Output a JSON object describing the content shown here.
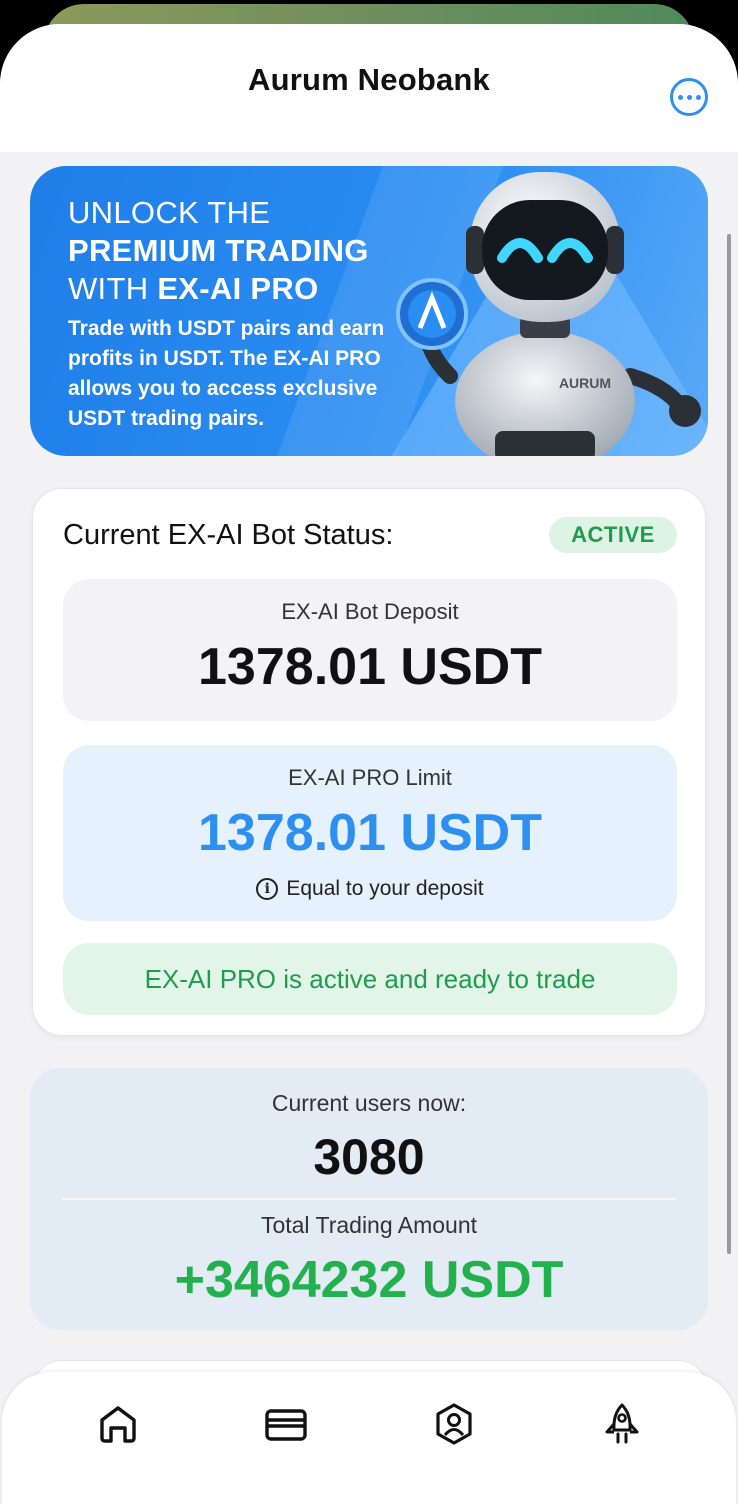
{
  "header": {
    "title": "Aurum Neobank",
    "more_icon": "more-horizontal-icon"
  },
  "banner": {
    "line1": "UNLOCK THE",
    "line2": "PREMIUM TRADING",
    "line3_prefix": "WITH ",
    "line3_bold": "EX-AI PRO",
    "body": "Trade with USDT pairs and earn profits in USDT. The EX-AI PRO allows you to access exclusive USDT trading pairs.",
    "robot_badge": "AURUM"
  },
  "status": {
    "label": "Current EX-AI Bot Status:",
    "badge": "ACTIVE",
    "deposit_label": "EX-AI Bot Deposit",
    "deposit_value": "1378.01 USDT",
    "limit_label": "EX-AI PRO Limit",
    "limit_value": "1378.01 USDT",
    "limit_note": "Equal to your deposit",
    "ready_text": "EX-AI PRO is active and ready to trade"
  },
  "stats": {
    "users_label": "Current users now:",
    "users_value": "3080",
    "amount_label": "Total Trading Amount",
    "amount_value": "+3464232 USDT"
  },
  "nav": {
    "items": [
      {
        "icon": "home-icon"
      },
      {
        "icon": "wallet-card-icon"
      },
      {
        "icon": "user-shield-icon"
      },
      {
        "icon": "rocket-icon"
      }
    ]
  },
  "colors": {
    "accent": "#2d8ff0",
    "success": "#1f9d4e",
    "profit": "#23b14d",
    "banner": "#1f7de8"
  }
}
